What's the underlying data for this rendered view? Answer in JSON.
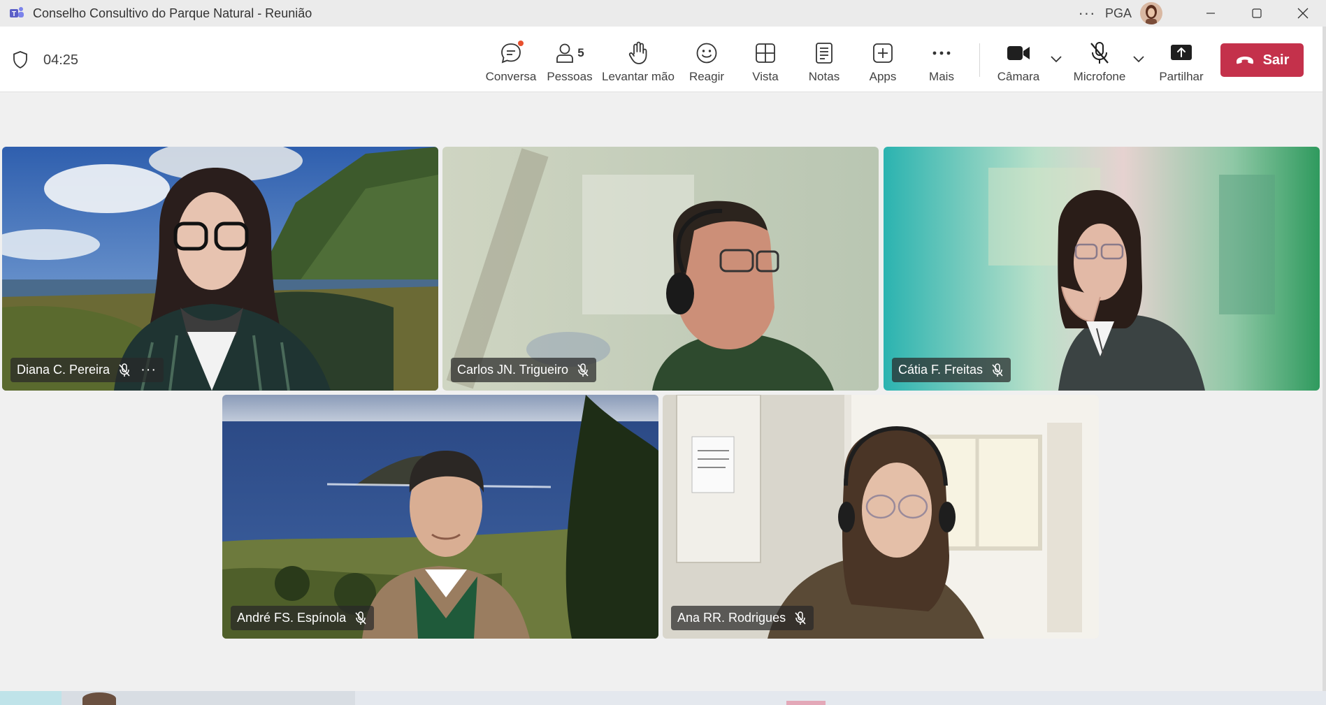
{
  "window": {
    "title": "Conselho Consultivo do Parque Natural - Reunião",
    "more_label": "···",
    "org": "PGA"
  },
  "toolbar": {
    "timer": "04:25",
    "items": [
      {
        "label": "Conversa",
        "icon": "chat-icon"
      },
      {
        "label": "Pessoas",
        "icon": "people-icon",
        "count": "5"
      },
      {
        "label": "Levantar mão",
        "icon": "raise-hand-icon"
      },
      {
        "label": "Reagir",
        "icon": "smile-icon"
      },
      {
        "label": "Vista",
        "icon": "grid-icon"
      },
      {
        "label": "Notas",
        "icon": "notes-icon"
      },
      {
        "label": "Apps",
        "icon": "plus-square-icon"
      },
      {
        "label": "Mais",
        "icon": "more-icon"
      },
      {
        "label": "Câmara",
        "icon": "camera-icon"
      },
      {
        "label": "Microfone",
        "icon": "mic-off-icon"
      },
      {
        "label": "Partilhar",
        "icon": "share-icon"
      }
    ],
    "leave_label": "Sair"
  },
  "participants": [
    {
      "name": "Diana C. Pereira",
      "muted": true,
      "has_more": true,
      "more_label": "···"
    },
    {
      "name": "Carlos JN. Trigueiro",
      "muted": true
    },
    {
      "name": "Cátia F. Freitas",
      "muted": true
    },
    {
      "name": "André FS. Espínola",
      "muted": true
    },
    {
      "name": "Ana RR. Rodrigues",
      "muted": true
    }
  ],
  "colors": {
    "leave": "#c4314b",
    "accent": "#5b5fc7",
    "notification": "#e8502e"
  }
}
